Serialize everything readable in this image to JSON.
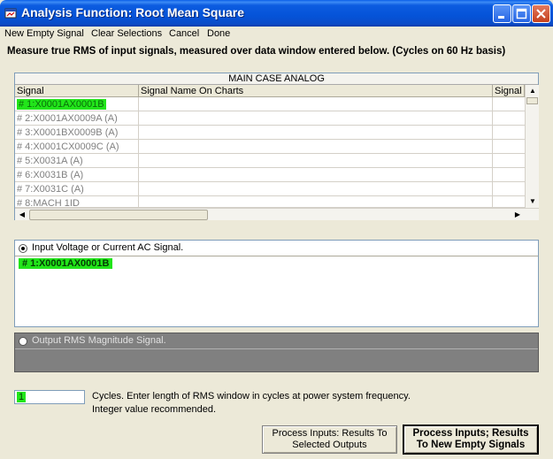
{
  "window": {
    "title": "Analysis Function:  Root Mean Square"
  },
  "menu": {
    "items": [
      "New Empty Signal",
      "Clear Selections",
      "Cancel",
      "Done"
    ]
  },
  "description": "Measure true RMS of input signals, measured over data window entered below.  (Cycles on  60 Hz basis)",
  "grid": {
    "caption": "MAIN   CASE   ANALOG",
    "columns": [
      "Signal",
      "Signal Name On Charts",
      "Signal"
    ],
    "rows": [
      {
        "signal": "# 1:X0001AX0001B",
        "selected": true
      },
      {
        "signal": "# 2:X0001AX0009A (A)",
        "selected": false
      },
      {
        "signal": "# 3:X0001BX0009B (A)",
        "selected": false
      },
      {
        "signal": "# 4:X0001CX0009C (A)",
        "selected": false
      },
      {
        "signal": "# 5:X0031A (A)",
        "selected": false
      },
      {
        "signal": "# 6:X0031B (A)",
        "selected": false
      },
      {
        "signal": "# 7:X0031C (A)",
        "selected": false
      },
      {
        "signal": "# 8:MACH 1ID",
        "selected": false
      }
    ]
  },
  "input_panel": {
    "label": "Input Voltage or Current AC Signal.",
    "selected_signal": "# 1:X0001AX0001B"
  },
  "output_panel": {
    "label": "Output RMS Magnitude Signal."
  },
  "cycles": {
    "value": "1",
    "label_line1": "Cycles.  Enter length of RMS window in cycles at power system frequency.",
    "label_line2": "Integer value recommended."
  },
  "buttons": {
    "process_selected_line1": "Process Inputs:   Results To",
    "process_selected_line2": "Selected Outputs",
    "process_new_line1": "Process Inputs;   Results",
    "process_new_line2": "To New Empty Signals"
  },
  "colors": {
    "titlebar": "#0553d8",
    "highlight": "#22e51a",
    "output_panel": "#808080"
  }
}
